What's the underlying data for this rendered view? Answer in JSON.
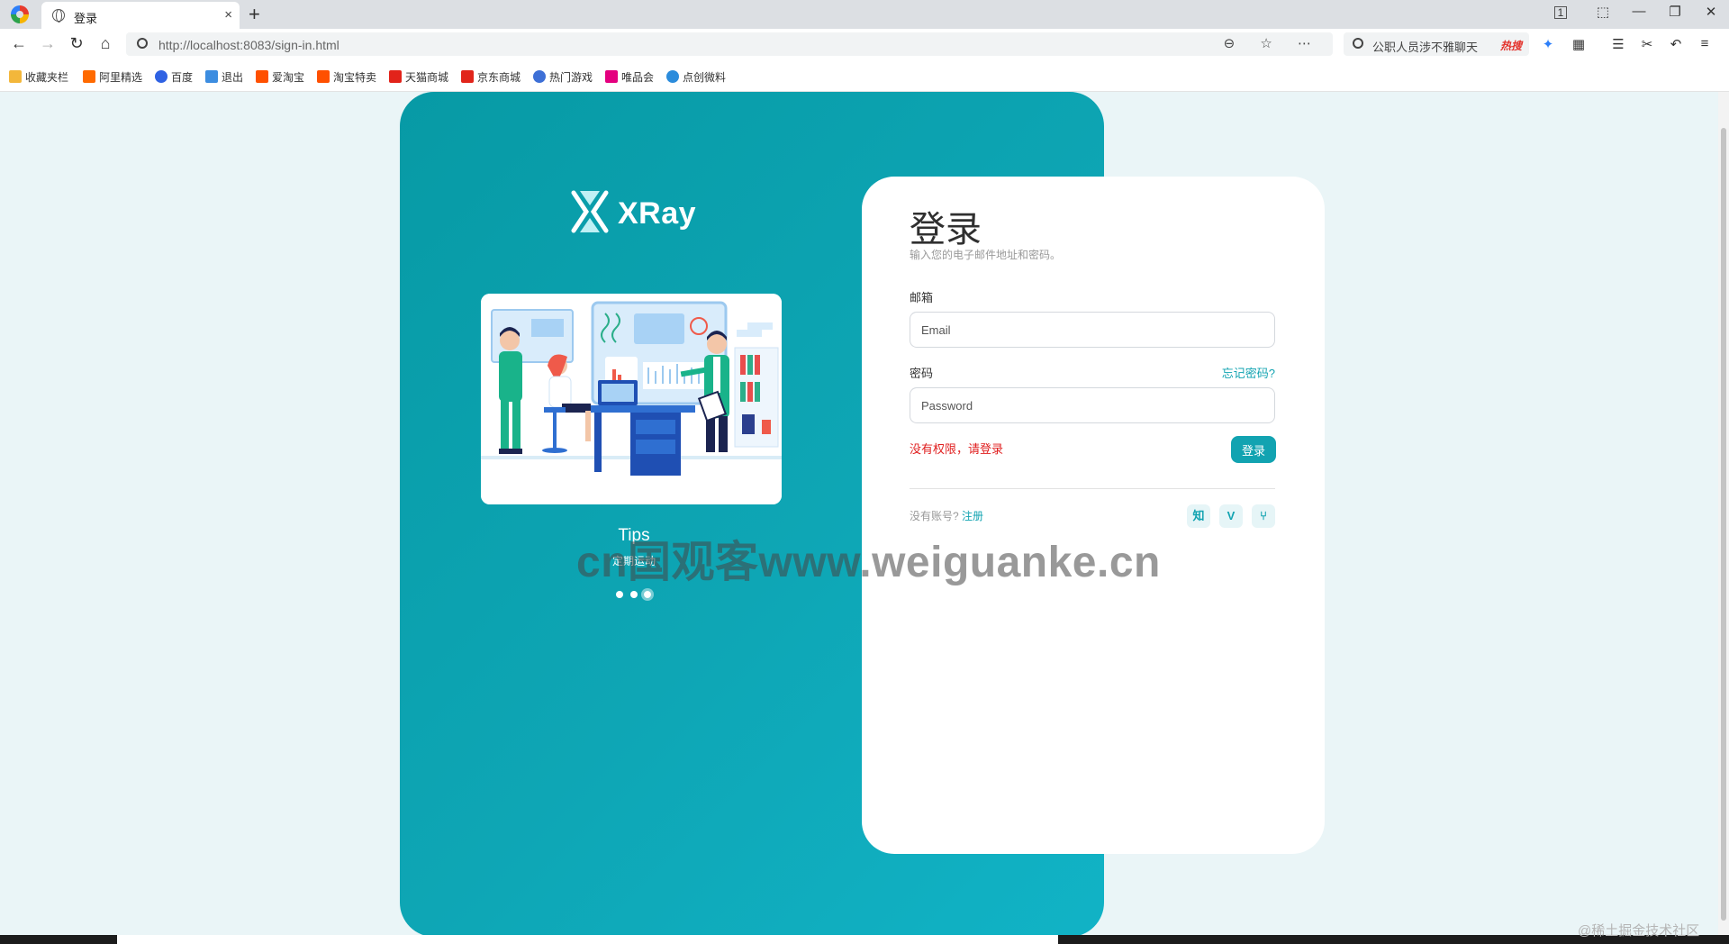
{
  "browser": {
    "tab_title": "登录",
    "tab_close": "×",
    "new_tab": "+",
    "url": "http://localhost:8083/sign-in.html",
    "search_text": "公职人员涉不雅聊天",
    "search_hot": "热搜",
    "window_controls": [
      "1",
      "⬚",
      "—",
      "❐",
      "✕"
    ],
    "nav": {
      "back": "←",
      "forward": "→",
      "reload": "↻",
      "home": "⌂"
    },
    "address_actions": "⊖ ☆ ⋯",
    "extensions": [
      "✦",
      "▦",
      "☰",
      "✂",
      "↶",
      "≡"
    ]
  },
  "bookmarks": [
    {
      "label": "收藏夹栏",
      "icon_color": "#f3b73b",
      "icon": "folder-icon"
    },
    {
      "label": "阿里精选",
      "icon_color": "#ff6a00",
      "icon": "ali-icon"
    },
    {
      "label": "百度",
      "icon_color": "#2f62e3",
      "icon": "baidu-icon"
    },
    {
      "label": "退出",
      "icon_color": "#3c8de0",
      "icon": "feather-icon"
    },
    {
      "label": "爱淘宝",
      "icon_color": "#ff5000",
      "icon": "taobao-icon"
    },
    {
      "label": "淘宝特卖",
      "icon_color": "#ff5000",
      "icon": "taobao-sale-icon"
    },
    {
      "label": "天猫商城",
      "icon_color": "#e2231a",
      "icon": "tmall-icon"
    },
    {
      "label": "京东商城",
      "icon_color": "#e1251b",
      "icon": "jd-icon"
    },
    {
      "label": "热门游戏",
      "icon_color": "#3d6fd6",
      "icon": "game-icon"
    },
    {
      "label": "唯品会",
      "icon_color": "#e4007f",
      "icon": "vip-icon"
    },
    {
      "label": "点创微料",
      "icon_color": "#2b8cdc",
      "icon": "edge-icon"
    }
  ],
  "left_panel": {
    "logo_text": "XRay",
    "tips_title": "Tips",
    "tips_subtitle": "定期运动",
    "carousel_total": 3,
    "carousel_active": 3
  },
  "login": {
    "title": "登录",
    "description": "输入您的电子邮件地址和密码。",
    "email_label": "邮箱",
    "email_placeholder": "Email",
    "password_label": "密码",
    "password_placeholder": "Password",
    "forgot": "忘记密码?",
    "error": "没有权限，请登录",
    "submit": "登录",
    "no_account": "没有账号?",
    "register": "注册",
    "social": [
      {
        "label": "知",
        "icon": "zhihu-icon"
      },
      {
        "label": "V",
        "icon": "vue-icon"
      },
      {
        "label": "⑂",
        "icon": "git-branch-icon"
      }
    ]
  },
  "overlays": {
    "watermark": "cn国观客www.weiguanke.cn",
    "corner_mark": "@稀土掘金技术社区"
  },
  "colors": {
    "primary": "#12a3b1",
    "panel": "#0ea6b5",
    "error": "#e02020",
    "page_bg": "#eaf5f7"
  }
}
